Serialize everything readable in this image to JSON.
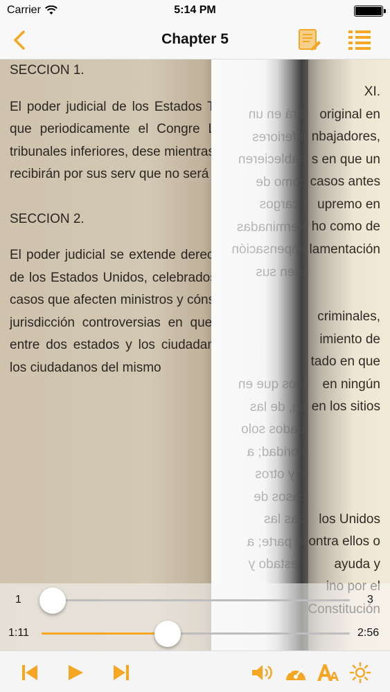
{
  "status_bar": {
    "carrier": "Carrier",
    "time": "5:14 PM"
  },
  "nav": {
    "title": "Chapter 5"
  },
  "left_text": {
    "paragraphs": [
      "SECCION 1.",
      "El poder judicial de los Estados Tribunal Supremo y en aque que periodicamente el Congre Los jueces, tanto del Tribu tribunales inferiores, dese mientras observen buena con fechas recibirán por sus serv que no será rebajada mie cargos.",
      "SECCION 2.",
      "El poder judicial se extende derecho y equidad surja de leyes de los Estados Unidos, celebrados o que se celebra todos los casos que afecten ministros y cónsules públicos almirantazgo y jurisdicción controversias en que los Esta las controversias entre dos estados y los ciudadanos ciudadanos de diferente los ciudadanos del mismo"
    ]
  },
  "right_text": {
    "lines": [
      "XI.",
      "original en",
      "nbajadores,",
      "s en que un",
      "casos antes",
      "upremo en",
      "ho como de",
      "lamentación",
      "",
      "",
      "criminales,",
      "imiento de",
      "tado en que",
      "en ningún",
      "en los sitios",
      "",
      "",
      "",
      "",
      "los Unidos",
      "ontra ellos o",
      "ayuda y",
      "ino por el",
      "Constitución"
    ]
  },
  "mirror_text": {
    "lines": [
      "sidirá en un",
      "s inferiores",
      "establecieren",
      "s como de",
      "us cargos",
      "determinadas",
      "compensación",
      "peñen sus",
      "",
      "",
      "",
      "",
      "casos que en",
      "ción, de las",
      "tratados solo",
      "autoridad; a",
      "res y otros",
      "s casos de",
      "todas las",
      "sea parte; a",
      "un estado y",
      "",
      "",
      ""
    ]
  },
  "controls": {
    "page_slider": {
      "min_label": "1",
      "max_label": "3",
      "value_fraction": 0.0
    },
    "time_slider": {
      "elapsed": "1:11",
      "total": "2:56",
      "value_fraction": 0.41
    }
  },
  "colors": {
    "accent": "#f5a623",
    "nav_bg": "#f8f8f8",
    "page_bg": "#d3c8b3"
  },
  "icons": {
    "back": "chevron-left-icon",
    "edit": "note-edit-icon",
    "toc": "list-icon",
    "rewind": "skip-back-icon",
    "play": "play-icon",
    "forward": "skip-forward-icon",
    "volume": "speaker-icon",
    "speed": "speedometer-icon",
    "font": "font-size-icon",
    "brightness": "sun-icon"
  }
}
